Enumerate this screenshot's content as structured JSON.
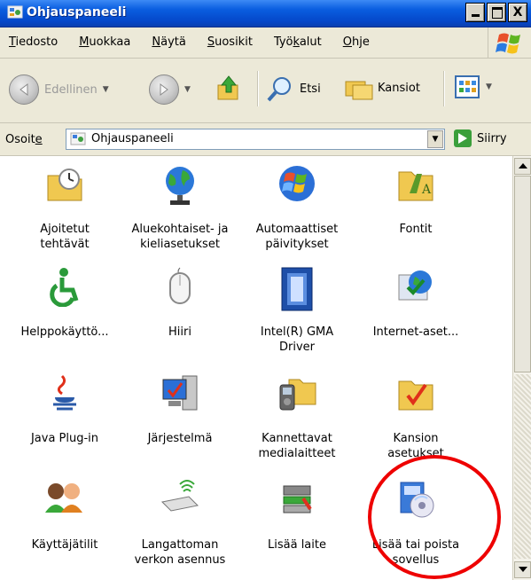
{
  "window": {
    "title": "Ohjauspaneeli",
    "title_icon": "control-panel-icon",
    "close_label": "X"
  },
  "menu": [
    {
      "prefix": "",
      "u": "T",
      "rest": "iedosto"
    },
    {
      "prefix": "",
      "u": "M",
      "rest": "uokkaa"
    },
    {
      "prefix": "",
      "u": "N",
      "rest": "äytä"
    },
    {
      "prefix": "",
      "u": "S",
      "rest": "uosikit"
    },
    {
      "prefix": "Työ",
      "u": "k",
      "rest": "alut"
    },
    {
      "prefix": "",
      "u": "O",
      "rest": "hje"
    }
  ],
  "toolbar": {
    "back_label": "Edellinen",
    "search_label": "Etsi",
    "folders_label": "Kansiot"
  },
  "address": {
    "label_prefix": "Osoit",
    "label_u": "e",
    "value": "Ohjauspaneeli",
    "go_label": "Siirry"
  },
  "items": [
    {
      "line1": "Ajoitetut",
      "line2": "tehtävät",
      "icon": "scheduled-tasks-icon"
    },
    {
      "line1": "Aluekohtaiset- ja",
      "line2": "kieliasetukset",
      "icon": "globe-icon"
    },
    {
      "line1": "Automaattiset",
      "line2": "päivitykset",
      "icon": "windows-update-icon"
    },
    {
      "line1": "Fontit",
      "line2": "",
      "icon": "fonts-folder-icon"
    },
    {
      "line1": "Helppokäyttö...",
      "line2": "",
      "icon": "accessibility-icon"
    },
    {
      "line1": "Hiiri",
      "line2": "",
      "icon": "mouse-icon"
    },
    {
      "line1": "Intel(R) GMA",
      "line2": "Driver",
      "icon": "intel-gma-icon"
    },
    {
      "line1": "Internet-aset...",
      "line2": "",
      "icon": "internet-options-icon"
    },
    {
      "line1": "Java Plug-in",
      "line2": "",
      "icon": "java-icon"
    },
    {
      "line1": "Järjestelmä",
      "line2": "",
      "icon": "system-icon"
    },
    {
      "line1": "Kannettavat",
      "line2": "medialaitteet",
      "icon": "portable-media-icon"
    },
    {
      "line1": "Kansion",
      "line2": "asetukset",
      "icon": "folder-options-icon"
    },
    {
      "line1": "Käyttäjätilit",
      "line2": "",
      "icon": "user-accounts-icon"
    },
    {
      "line1": "Langattoman",
      "line2": "verkon asennus",
      "icon": "wireless-setup-icon"
    },
    {
      "line1": "Lisää laite",
      "line2": "",
      "icon": "add-hardware-icon"
    },
    {
      "line1": "Lisää tai poista",
      "line2": "sovellus",
      "icon": "add-remove-programs-icon"
    }
  ],
  "colors": {
    "titlebar": "#0a5ee0",
    "chrome": "#ece9d8",
    "highlight_circle": "#ee0000"
  }
}
